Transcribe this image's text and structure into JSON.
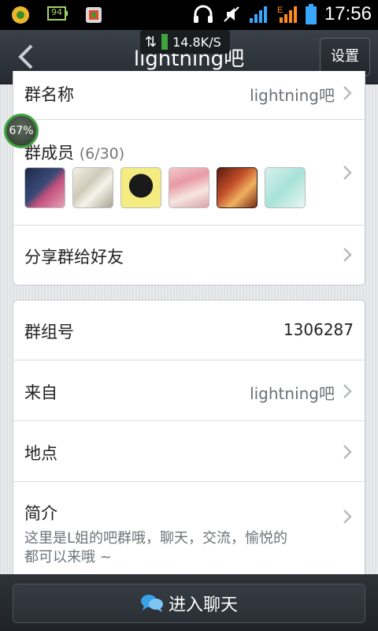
{
  "status_bar": {
    "time": "17:56",
    "battery_label": "94",
    "speed_text": "14.8K/S"
  },
  "header": {
    "title": "lightning吧",
    "settings_label": "设置"
  },
  "overlay": {
    "percent_label": "67%"
  },
  "group_card": {
    "name_label": "群名称",
    "name_value": "lightning吧",
    "members_label": "群成员",
    "members_count": "(6/30)",
    "share_label": "分享群给好友"
  },
  "info_card": {
    "group_id_label": "群组号",
    "group_id_value": "1306287",
    "from_label": "来自",
    "from_value": "lightning吧",
    "location_label": "地点",
    "intro_label": "简介",
    "intro_text_line1": "这里是L姐的吧群哦，聊天，交流，愉悦的",
    "intro_text_line2": "都可以来哦 ~"
  },
  "footer": {
    "chat_button_label": "进入聊天"
  },
  "colors": {
    "accent_green": "#3fa43f",
    "chat_icon_blue": "#3aa0e8"
  }
}
